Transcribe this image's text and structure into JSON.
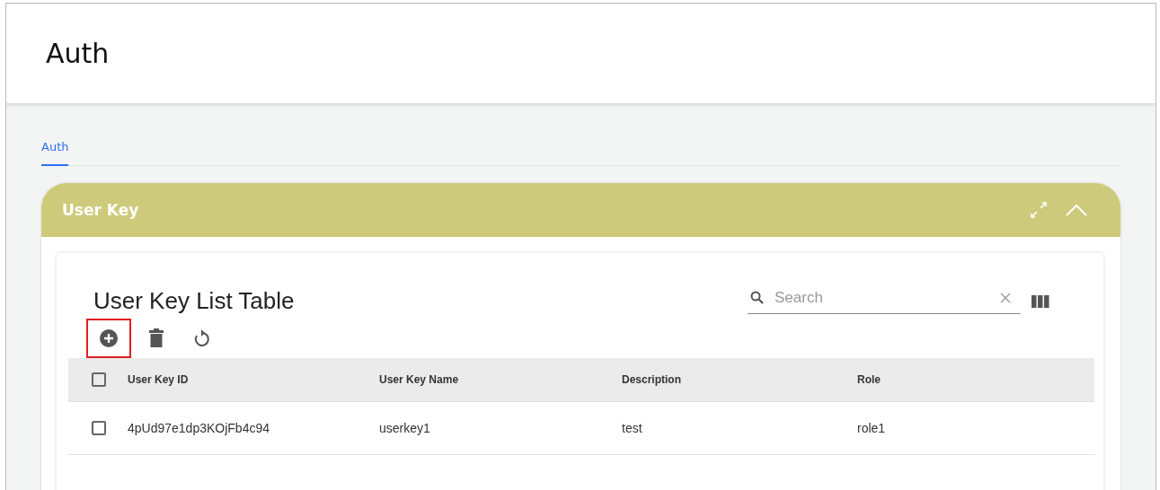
{
  "page": {
    "title": "Auth"
  },
  "tabs": [
    {
      "label": "Auth",
      "selected": true
    }
  ],
  "panel": {
    "title": "User Key",
    "expanded": true
  },
  "table_card": {
    "title": "User Key List Table",
    "search": {
      "placeholder": "Search"
    },
    "toolbar": [
      {
        "kind": "add",
        "highlighted": true
      },
      {
        "kind": "delete",
        "highlighted": false
      },
      {
        "kind": "refresh",
        "highlighted": false
      }
    ],
    "columns": [
      "User Key ID",
      "User Key Name",
      "Description",
      "Role"
    ],
    "header_checked": false,
    "rows": [
      {
        "checked": false,
        "cells": [
          "4pUd97e1dp3KOjFb4c94",
          "userkey1",
          "test",
          "role1"
        ]
      }
    ]
  }
}
